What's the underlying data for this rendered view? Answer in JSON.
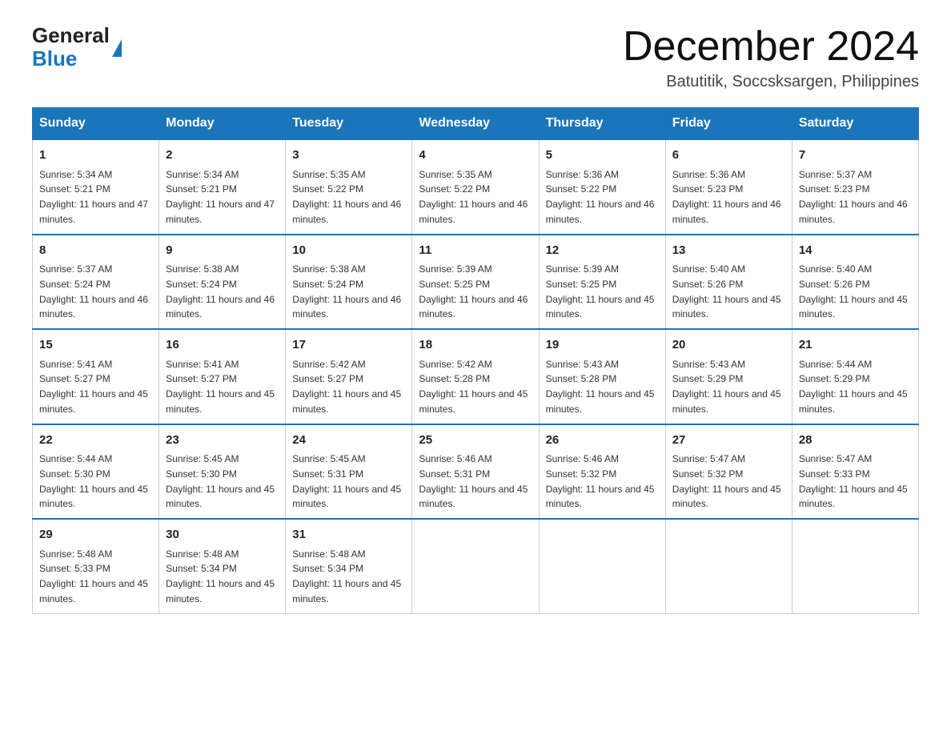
{
  "header": {
    "logo_general": "General",
    "logo_blue": "Blue",
    "month_title": "December 2024",
    "location": "Batutitik, Soccsksargen, Philippines"
  },
  "weekdays": [
    "Sunday",
    "Monday",
    "Tuesday",
    "Wednesday",
    "Thursday",
    "Friday",
    "Saturday"
  ],
  "weeks": [
    [
      {
        "day": "1",
        "sunrise": "5:34 AM",
        "sunset": "5:21 PM",
        "daylight": "11 hours and 47 minutes."
      },
      {
        "day": "2",
        "sunrise": "5:34 AM",
        "sunset": "5:21 PM",
        "daylight": "11 hours and 47 minutes."
      },
      {
        "day": "3",
        "sunrise": "5:35 AM",
        "sunset": "5:22 PM",
        "daylight": "11 hours and 46 minutes."
      },
      {
        "day": "4",
        "sunrise": "5:35 AM",
        "sunset": "5:22 PM",
        "daylight": "11 hours and 46 minutes."
      },
      {
        "day": "5",
        "sunrise": "5:36 AM",
        "sunset": "5:22 PM",
        "daylight": "11 hours and 46 minutes."
      },
      {
        "day": "6",
        "sunrise": "5:36 AM",
        "sunset": "5:23 PM",
        "daylight": "11 hours and 46 minutes."
      },
      {
        "day": "7",
        "sunrise": "5:37 AM",
        "sunset": "5:23 PM",
        "daylight": "11 hours and 46 minutes."
      }
    ],
    [
      {
        "day": "8",
        "sunrise": "5:37 AM",
        "sunset": "5:24 PM",
        "daylight": "11 hours and 46 minutes."
      },
      {
        "day": "9",
        "sunrise": "5:38 AM",
        "sunset": "5:24 PM",
        "daylight": "11 hours and 46 minutes."
      },
      {
        "day": "10",
        "sunrise": "5:38 AM",
        "sunset": "5:24 PM",
        "daylight": "11 hours and 46 minutes."
      },
      {
        "day": "11",
        "sunrise": "5:39 AM",
        "sunset": "5:25 PM",
        "daylight": "11 hours and 46 minutes."
      },
      {
        "day": "12",
        "sunrise": "5:39 AM",
        "sunset": "5:25 PM",
        "daylight": "11 hours and 45 minutes."
      },
      {
        "day": "13",
        "sunrise": "5:40 AM",
        "sunset": "5:26 PM",
        "daylight": "11 hours and 45 minutes."
      },
      {
        "day": "14",
        "sunrise": "5:40 AM",
        "sunset": "5:26 PM",
        "daylight": "11 hours and 45 minutes."
      }
    ],
    [
      {
        "day": "15",
        "sunrise": "5:41 AM",
        "sunset": "5:27 PM",
        "daylight": "11 hours and 45 minutes."
      },
      {
        "day": "16",
        "sunrise": "5:41 AM",
        "sunset": "5:27 PM",
        "daylight": "11 hours and 45 minutes."
      },
      {
        "day": "17",
        "sunrise": "5:42 AM",
        "sunset": "5:27 PM",
        "daylight": "11 hours and 45 minutes."
      },
      {
        "day": "18",
        "sunrise": "5:42 AM",
        "sunset": "5:28 PM",
        "daylight": "11 hours and 45 minutes."
      },
      {
        "day": "19",
        "sunrise": "5:43 AM",
        "sunset": "5:28 PM",
        "daylight": "11 hours and 45 minutes."
      },
      {
        "day": "20",
        "sunrise": "5:43 AM",
        "sunset": "5:29 PM",
        "daylight": "11 hours and 45 minutes."
      },
      {
        "day": "21",
        "sunrise": "5:44 AM",
        "sunset": "5:29 PM",
        "daylight": "11 hours and 45 minutes."
      }
    ],
    [
      {
        "day": "22",
        "sunrise": "5:44 AM",
        "sunset": "5:30 PM",
        "daylight": "11 hours and 45 minutes."
      },
      {
        "day": "23",
        "sunrise": "5:45 AM",
        "sunset": "5:30 PM",
        "daylight": "11 hours and 45 minutes."
      },
      {
        "day": "24",
        "sunrise": "5:45 AM",
        "sunset": "5:31 PM",
        "daylight": "11 hours and 45 minutes."
      },
      {
        "day": "25",
        "sunrise": "5:46 AM",
        "sunset": "5:31 PM",
        "daylight": "11 hours and 45 minutes."
      },
      {
        "day": "26",
        "sunrise": "5:46 AM",
        "sunset": "5:32 PM",
        "daylight": "11 hours and 45 minutes."
      },
      {
        "day": "27",
        "sunrise": "5:47 AM",
        "sunset": "5:32 PM",
        "daylight": "11 hours and 45 minutes."
      },
      {
        "day": "28",
        "sunrise": "5:47 AM",
        "sunset": "5:33 PM",
        "daylight": "11 hours and 45 minutes."
      }
    ],
    [
      {
        "day": "29",
        "sunrise": "5:48 AM",
        "sunset": "5:33 PM",
        "daylight": "11 hours and 45 minutes."
      },
      {
        "day": "30",
        "sunrise": "5:48 AM",
        "sunset": "5:34 PM",
        "daylight": "11 hours and 45 minutes."
      },
      {
        "day": "31",
        "sunrise": "5:48 AM",
        "sunset": "5:34 PM",
        "daylight": "11 hours and 45 minutes."
      },
      null,
      null,
      null,
      null
    ]
  ],
  "labels": {
    "sunrise": "Sunrise: ",
    "sunset": "Sunset: ",
    "daylight": "Daylight: "
  }
}
